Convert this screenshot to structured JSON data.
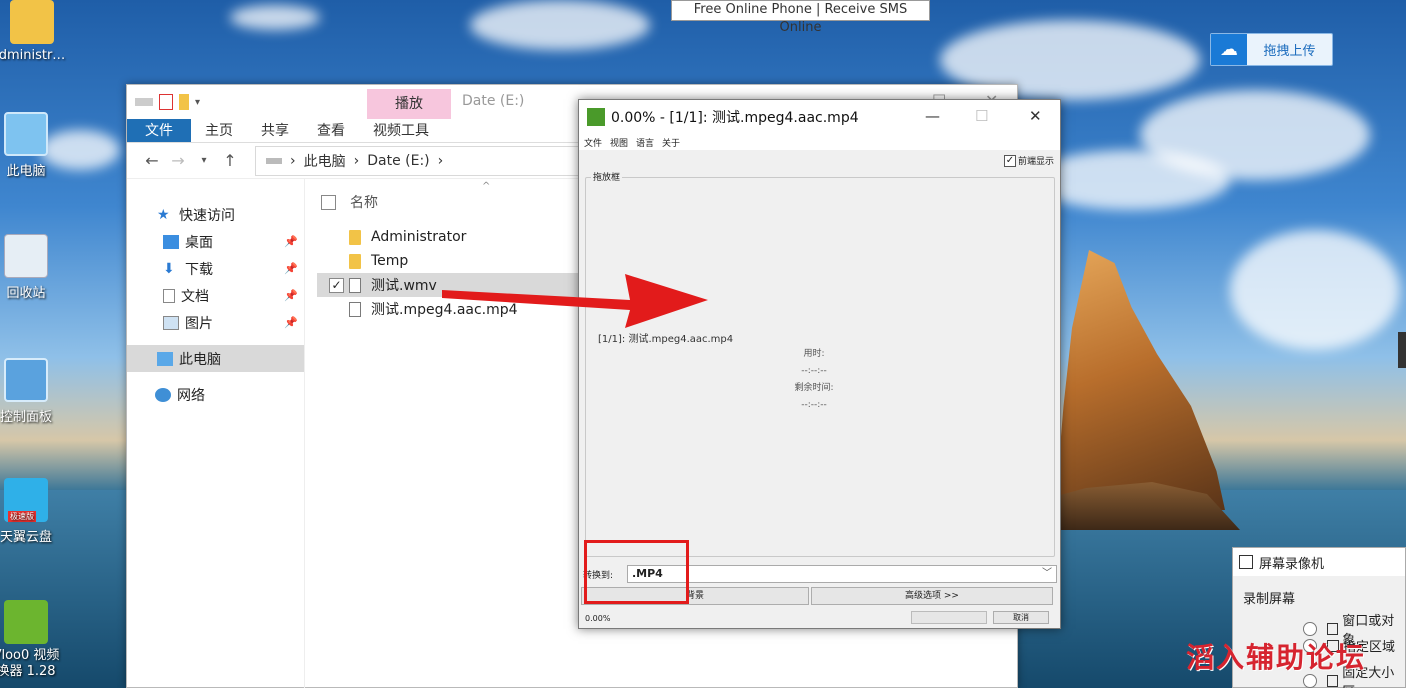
{
  "tooltip": {
    "text": "Free Online Phone | Receive SMS Online"
  },
  "upload_button": {
    "label": "拖拽上传"
  },
  "desktop_icons": [
    {
      "label": "dministr…"
    },
    {
      "label": "此电脑"
    },
    {
      "label": "回收站"
    },
    {
      "label": "控制面板"
    },
    {
      "label": "天翼云盘"
    },
    {
      "label": "Vloo0 视频"
    },
    {
      "label": "换器 1.28"
    }
  ],
  "desktop_badge": {
    "label": "极速版"
  },
  "explorer": {
    "title": "Date (E:)",
    "context_tab": "播放",
    "ribbon_tabs": [
      "文件",
      "主页",
      "共享",
      "查看",
      "视频工具"
    ],
    "breadcrumb": [
      "此电脑",
      "Date (E:)"
    ],
    "nav": {
      "quick_access": "快速访问",
      "items": [
        "桌面",
        "下载",
        "文档",
        "图片"
      ],
      "this_pc": "此电脑",
      "network": "网络"
    },
    "column_header": "名称",
    "files": [
      {
        "name": "Administrator",
        "type": "folder"
      },
      {
        "name": "Temp",
        "type": "folder"
      },
      {
        "name": "测试.wmv",
        "type": "video",
        "selected": true
      },
      {
        "name": "测试.mpeg4.aac.mp4",
        "type": "video"
      }
    ]
  },
  "converter": {
    "title": "0.00% - [1/1]: 测试.mpeg4.aac.mp4",
    "menu": [
      "文件",
      "视图",
      "语言",
      "关于"
    ],
    "front_display": "前端显示",
    "drop_box_label": "拖放框",
    "status_line": "[1/1]: 测试.mpeg4.aac.mp4",
    "elapsed_label": "用时:",
    "elapsed_value": "--:--:--",
    "remaining_label": "剩余时间:",
    "remaining_value": "--:--:--",
    "convert_to_label": "转换到:",
    "format_value": ".MP4",
    "background_button": "背景",
    "advanced_button": "高级选项 >>",
    "progress_text": "0.00%",
    "cancel_button": "取消"
  },
  "recorder": {
    "title": "屏幕录像机",
    "group_label": "录制屏幕",
    "options": [
      "窗口或对象",
      "指定区域",
      "固定大小区"
    ]
  },
  "watermark": "滔入辅助论坛"
}
